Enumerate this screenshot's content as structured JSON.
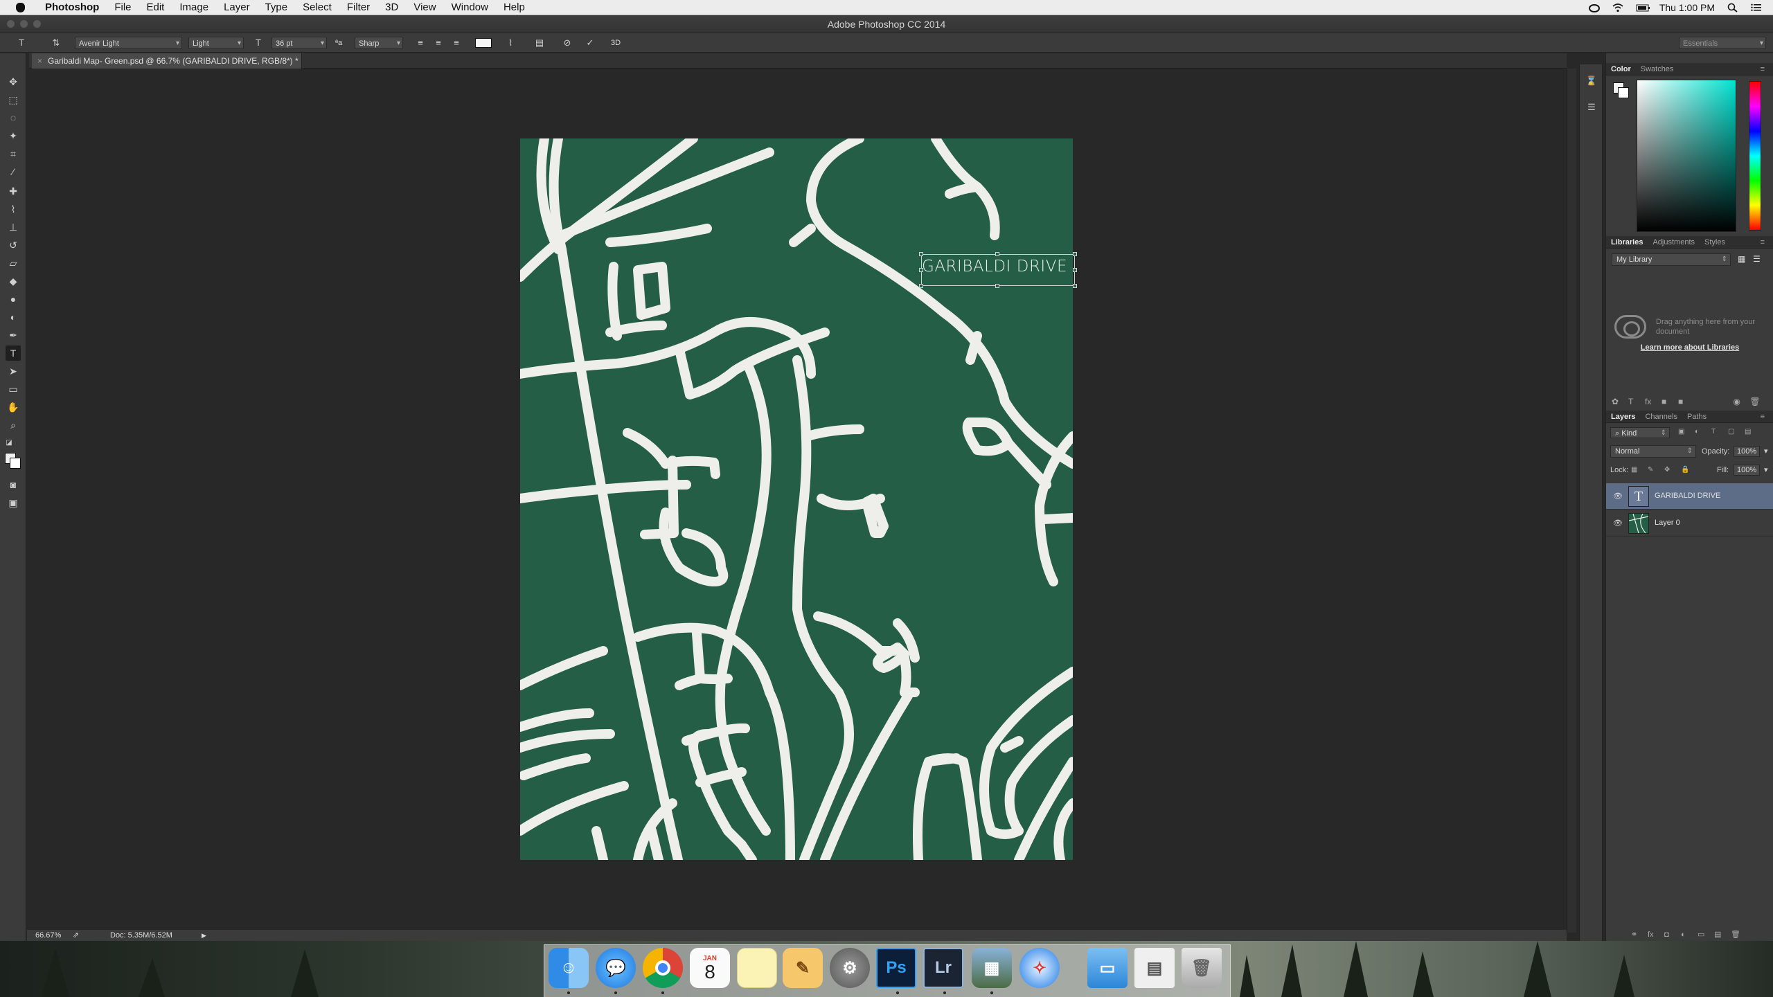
{
  "menubar": {
    "app": "Photoshop",
    "items": [
      "File",
      "Edit",
      "Image",
      "Layer",
      "Type",
      "Select",
      "Filter",
      "3D",
      "View",
      "Window",
      "Help"
    ],
    "clock": "Thu 1:00 PM"
  },
  "window": {
    "title": "Adobe Photoshop CC 2014"
  },
  "options": {
    "font_family": "Avenir Light",
    "font_style": "Light",
    "font_size": "36 pt",
    "aa_label": "ªa",
    "antialias": "Sharp",
    "workspace": "Essentials"
  },
  "document": {
    "tab_title": "Garibaldi Map- Green.psd @ 66.7% (GARIBALDI DRIVE, RGB/8*) *",
    "text_layer_content": "GARIBALDI DRIVE",
    "background_color": "#255e46",
    "road_color": "#eeeeea"
  },
  "status": {
    "zoom": "66.67%",
    "doc_size": "Doc: 5.35M/6.52M"
  },
  "panels": {
    "color_tabs": [
      "Color",
      "Swatches"
    ],
    "library_tabs": [
      "Libraries",
      "Adjustments",
      "Styles"
    ],
    "library_select": "My Library",
    "library_hint": "Drag anything here from your document",
    "library_link": "Learn more about Libraries",
    "layers_tabs": [
      "Layers",
      "Channels",
      "Paths"
    ],
    "filter_kind": "Kind",
    "blend_mode": "Normal",
    "opacity_label": "Opacity:",
    "opacity_value": "100%",
    "lock_label": "Lock:",
    "fill_label": "Fill:",
    "fill_value": "100%",
    "layers": [
      {
        "name": "GARIBALDI DRIVE",
        "type": "text",
        "selected": true
      },
      {
        "name": "Layer 0",
        "type": "image",
        "selected": false
      }
    ]
  },
  "dock": {
    "calendar_month": "JAN",
    "calendar_day": "8",
    "ps_label": "Ps",
    "lr_label": "Lr"
  }
}
